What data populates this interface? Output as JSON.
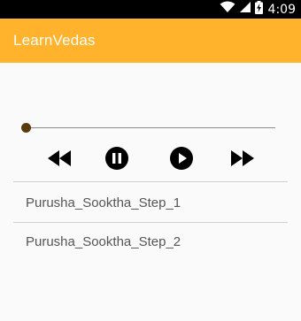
{
  "status_bar": {
    "time": "4:09",
    "icons": [
      "wifi-icon",
      "signal-icon",
      "battery-charging-icon"
    ]
  },
  "app_bar": {
    "title": "LearnVedas",
    "color": "#ffb22b"
  },
  "player": {
    "progress": 0,
    "controls": [
      "rewind-icon",
      "pause-icon",
      "play-icon",
      "fast-forward-icon"
    ]
  },
  "tracks": [
    {
      "label": "Purusha_Sooktha_Step_1"
    },
    {
      "label": "Purusha_Sooktha_Step_2"
    }
  ]
}
